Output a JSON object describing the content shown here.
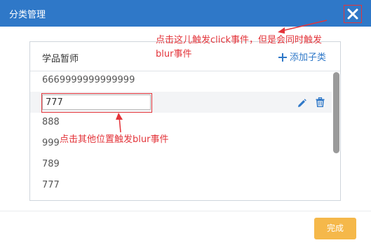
{
  "dialog": {
    "title": "分类管理",
    "close_icon": "close-x-icon"
  },
  "panel": {
    "title": "学品暂师",
    "add_label": "添加子类",
    "add_icon": "plus-icon",
    "items": [
      {
        "label": "6669999999999999"
      },
      {
        "label": "777",
        "editing": true
      },
      {
        "label": "888"
      },
      {
        "label": "999"
      },
      {
        "label": "789"
      },
      {
        "label": "777"
      }
    ],
    "row_actions": {
      "edit_icon": "pencil-icon",
      "delete_icon": "trash-icon"
    }
  },
  "annotations": {
    "top_note_line1": "点击这儿触发click事件，但是会同时触发",
    "top_note_line2": "blur事件",
    "bottom_note": "点击其他位置触发blur事件",
    "color": "#e3343a"
  },
  "footer": {
    "done_label": "完成"
  },
  "colors": {
    "titlebar": "#2f78c8",
    "accent": "#2f78c8",
    "done_button": "#f5b84a"
  }
}
